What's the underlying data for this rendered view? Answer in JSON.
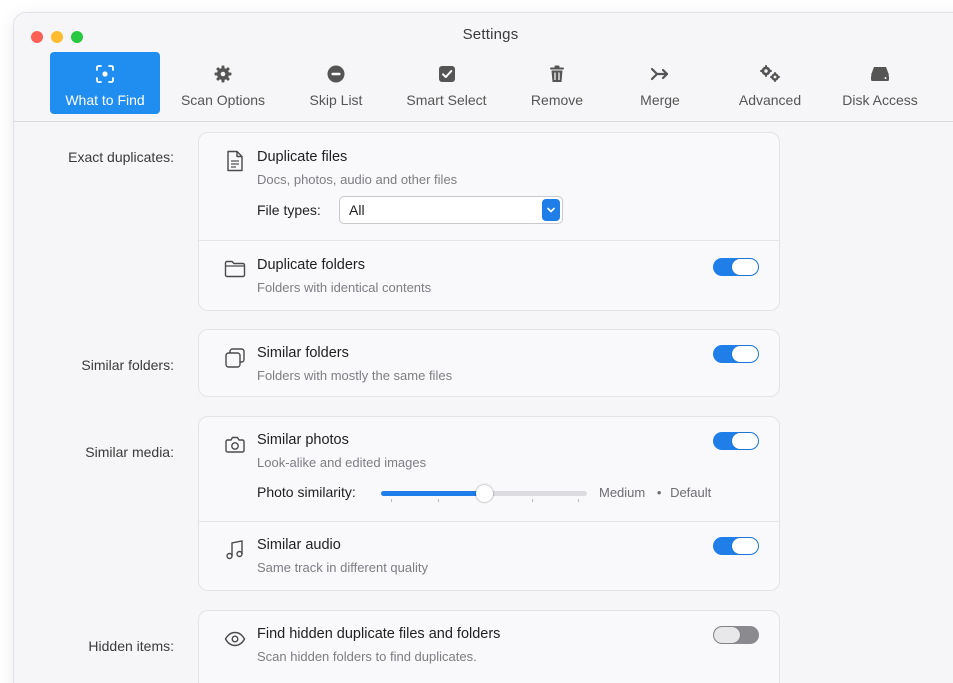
{
  "window": {
    "title": "Settings"
  },
  "toolbar": {
    "items": [
      {
        "label": "What to Find",
        "icon": "target-icon",
        "active": true
      },
      {
        "label": "Scan Options",
        "icon": "gear-icon",
        "active": false
      },
      {
        "label": "Skip List",
        "icon": "minus-circle-icon",
        "active": false
      },
      {
        "label": "Smart Select",
        "icon": "checkbox-icon",
        "active": false
      },
      {
        "label": "Remove",
        "icon": "trash-icon",
        "active": false
      },
      {
        "label": "Merge",
        "icon": "merge-arrow-icon",
        "active": false
      },
      {
        "label": "Advanced",
        "icon": "gears-icon",
        "active": false
      },
      {
        "label": "Disk Access",
        "icon": "disk-icon",
        "active": false
      }
    ]
  },
  "sections": {
    "exact": {
      "label": "Exact duplicates:",
      "files": {
        "title": "Duplicate files",
        "subtitle": "Docs, photos, audio and other files",
        "file_types_label": "File types:",
        "file_types_value": "All"
      },
      "folders": {
        "title": "Duplicate folders",
        "subtitle": "Folders with identical contents",
        "enabled": true
      }
    },
    "similar_folders": {
      "label": "Similar folders:",
      "item": {
        "title": "Similar folders",
        "subtitle": "Folders with mostly the same files",
        "enabled": true
      }
    },
    "similar_media": {
      "label": "Similar media:",
      "photos": {
        "title": "Similar photos",
        "subtitle": "Look-alike and edited images",
        "enabled": true,
        "similarity_label": "Photo similarity:",
        "similarity_value": "Medium",
        "similarity_default": "Default",
        "similarity_level": 0.5
      },
      "audio": {
        "title": "Similar audio",
        "subtitle": "Same track in different quality",
        "enabled": true
      }
    },
    "hidden": {
      "label": "Hidden items:",
      "item": {
        "title": "Find hidden duplicate files and folders",
        "subtitle": "Scan hidden folders to find duplicates.",
        "enabled": false
      }
    }
  },
  "colors": {
    "accent": "#1f8ef0",
    "toggle_on": "#1f7ee8",
    "toggle_off": "#8a8a8f"
  }
}
